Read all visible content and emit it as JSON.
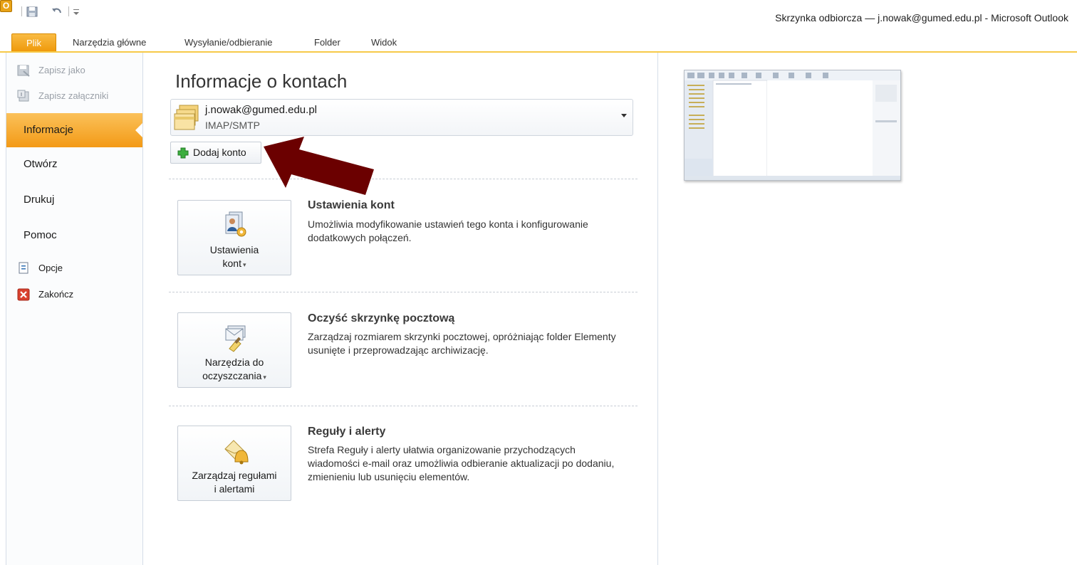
{
  "titlebar": {
    "window_title": "Skrzynka odbiorcza — j.nowak@gumed.edu.pl  -  Microsoft Outlook",
    "app_icon_letter": "O"
  },
  "ribbon": {
    "tabs": [
      {
        "label": "Plik"
      },
      {
        "label": "Narzędzia główne"
      },
      {
        "label": "Wysyłanie/odbieranie"
      },
      {
        "label": "Folder"
      },
      {
        "label": "Widok"
      }
    ],
    "accent_color": "#f6a51a"
  },
  "nav": {
    "save_as": "Zapisz jako",
    "save_attachments": "Zapisz załączniki",
    "info": "Informacje",
    "open": "Otwórz",
    "print": "Drukuj",
    "help": "Pomoc",
    "options": "Opcje",
    "exit": "Zakończ"
  },
  "main": {
    "title": "Informacje o kontach",
    "account": {
      "email": "j.nowak@gumed.edu.pl",
      "type": "IMAP/SMTP"
    },
    "add_account_label": "Dodaj konto",
    "sections": [
      {
        "button_line1": "Ustawienia",
        "button_line2": "kont",
        "title": "Ustawienia kont",
        "description": "Umożliwia modyfikowanie ustawień tego konta i konfigurowanie dodatkowych połączeń."
      },
      {
        "button_line1": "Narzędzia do",
        "button_line2": "oczyszczania",
        "title": "Oczyść skrzynkę pocztową",
        "description": "Zarządzaj rozmiarem skrzynki pocztowej, opróżniając folder Elementy usunięte i przeprowadzając archiwizację."
      },
      {
        "button_line1": "Zarządzaj regułami",
        "button_line2": "i alertami",
        "title": "Reguły i alerty",
        "description": "Strefa Reguły i alerty ułatwia organizowanie przychodzących wiadomości e-mail oraz umożliwia odbieranie aktualizacji po dodaniu, zmienieniu lub usunięciu elementów."
      }
    ]
  },
  "annotation": {
    "arrow_color": "#6b0000"
  }
}
